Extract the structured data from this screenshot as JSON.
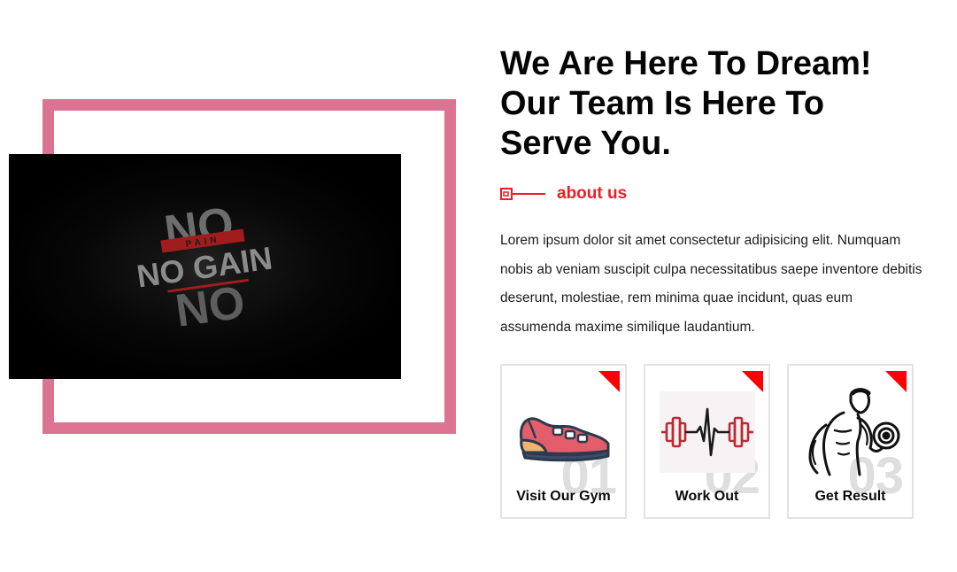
{
  "hero": {
    "image_text_top": "NO",
    "image_text_banner": "PAIN",
    "image_text_main": "NO GAIN",
    "image_text_bottom": "NO"
  },
  "headline": "We Are Here To Dream! Our Team Is Here To Serve You.",
  "about": {
    "label": "about us",
    "accent": "#ee1c24"
  },
  "description": "Lorem ipsum dolor sit amet consectetur adipisicing elit. Numquam nobis ab veniam suscipit culpa necessitatibus saepe inventore debitis deserunt, molestiae, rem minima quae incidunt, quas eum assumenda maxime similique laudantium.",
  "frame_color": "#dc7393",
  "cards": [
    {
      "number": "01",
      "label": "Visit Our Gym",
      "icon": "sneaker-icon"
    },
    {
      "number": "02",
      "label": "Work Out",
      "icon": "dumbbell-heartbeat-icon"
    },
    {
      "number": "03",
      "label": "Get Result",
      "icon": "bodybuilder-icon"
    }
  ]
}
